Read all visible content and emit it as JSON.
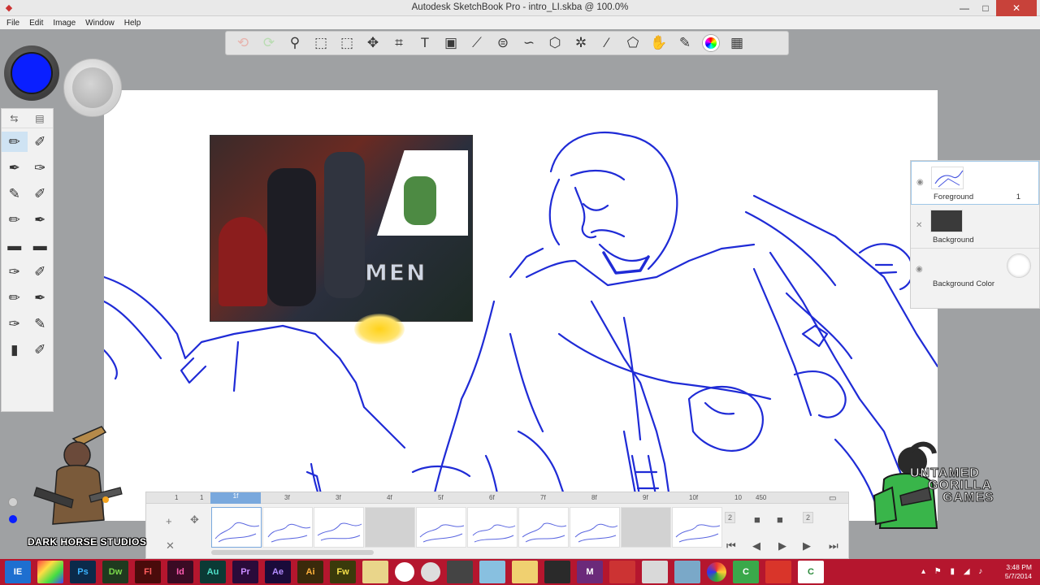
{
  "window": {
    "title": "Autodesk SketchBook Pro - intro_LI.skba @ 100.0%",
    "minimize": "—",
    "maximize": "□",
    "close": "✕"
  },
  "menu": [
    "File",
    "Edit",
    "Image",
    "Window",
    "Help"
  ],
  "toolbar": {
    "tools": [
      "undo-icon",
      "redo-icon",
      "zoom-icon",
      "selection-icon",
      "crop-icon",
      "move-icon",
      "transform-icon",
      "text-icon",
      "image-icon",
      "ruler-icon",
      "ellipse-icon",
      "french-curve-icon",
      "perspective-icon",
      "symmetry-icon",
      "line-icon",
      "shape-icon",
      "fill-icon",
      "brushes-icon",
      "color-wheel-icon",
      "copic-icon"
    ]
  },
  "colors": {
    "current_color": "#0a1fff",
    "taskbar": "#b5162e",
    "accent": "#79a8dd"
  },
  "layers": [
    {
      "name": "Foreground",
      "number": "1",
      "selected": true
    },
    {
      "name": "Background",
      "number": "",
      "selected": false
    },
    {
      "name": "Background Color",
      "number": "",
      "selected": false
    }
  ],
  "timeline": {
    "ruler_labels": [
      "1",
      "1",
      "1f",
      "3f",
      "3f",
      "4f",
      "5f",
      "6f",
      "7f",
      "8f",
      "9f",
      "10f",
      "10",
      "450"
    ],
    "controls": {
      "start_field": "2",
      "end_field": "2"
    }
  },
  "thumbnail_title": "MEN",
  "taskbar": {
    "apps": [
      "IE",
      "",
      "Ps",
      "Dw",
      "Fl",
      "Id",
      "Au",
      "Pr",
      "Ae",
      "Ai",
      "Fw",
      "",
      "",
      "",
      "",
      "",
      "",
      "",
      "M",
      "",
      "",
      "",
      "",
      "C",
      "",
      "C"
    ],
    "time": "3:48 PM",
    "date": "5/7/2014"
  },
  "logos": {
    "left": "DARK HORSE STUDIOS",
    "right_line1": "UNTAMED",
    "right_line2": "GORILLA",
    "right_line3": "GAMES"
  }
}
